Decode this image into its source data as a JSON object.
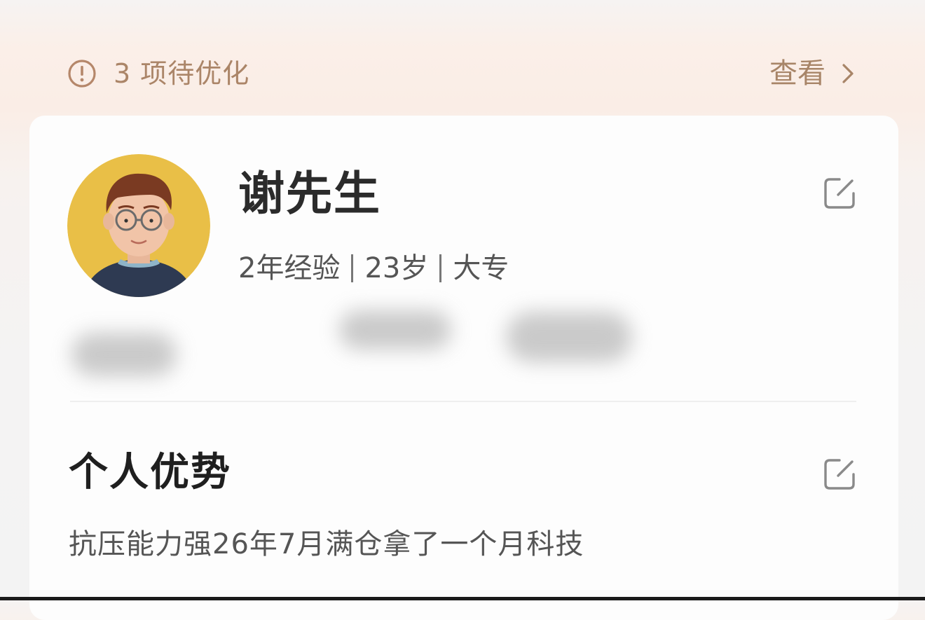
{
  "notice": {
    "icon": "alert-circle-icon",
    "count": "3",
    "text": "项待优化",
    "action_label": "查看",
    "action_icon": "chevron-right-icon"
  },
  "profile": {
    "name": "谢先生",
    "experience": "2年经验",
    "age": "23岁",
    "education": "大专",
    "avatar_icon": "avatar-illustration",
    "edit_icon": "edit-icon"
  },
  "advantage": {
    "title": "个人优势",
    "content": "抗压能力强26年7月满仓拿了一个月科技",
    "edit_icon": "edit-icon"
  },
  "colors": {
    "accent_brown": "#a88568",
    "avatar_bg": "#e9bf47"
  }
}
